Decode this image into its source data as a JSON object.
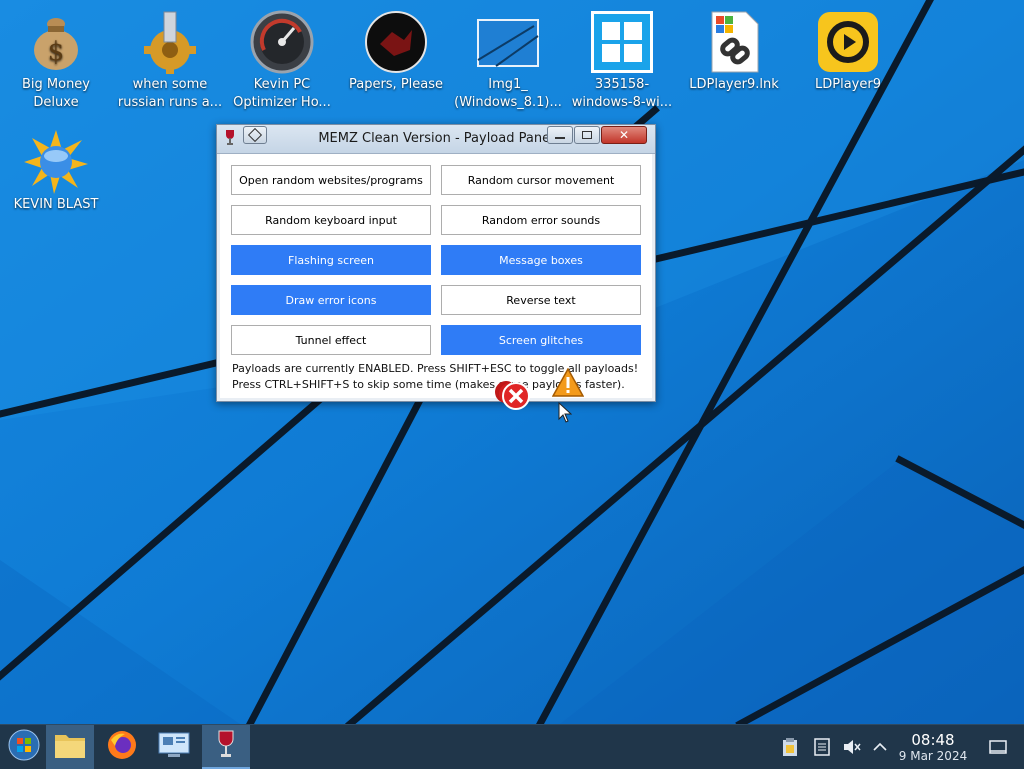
{
  "desktop_icons": [
    {
      "label_line1": "Big Money",
      "label_line2": "Deluxe",
      "icon": "money-bag-icon"
    },
    {
      "label_line1": "when some",
      "label_line2": "russian runs a...",
      "icon": "gear-icon"
    },
    {
      "label_line1": "Kevin PC",
      "label_line2": "Optimizer Ho...",
      "icon": "speedometer-icon"
    },
    {
      "label_line1": "Papers, Please",
      "label_line2": "",
      "icon": "papers-please-icon"
    },
    {
      "label_line1": "Img1_",
      "label_line2": "(Windows_8.1)...",
      "icon": "image-file-icon"
    },
    {
      "label_line1": "335158-",
      "label_line2": "windows-8-wi...",
      "icon": "windows-logo-icon"
    },
    {
      "label_line1": "LDPlayer9.lnk",
      "label_line2": "",
      "icon": "shortcut-link-icon"
    },
    {
      "label_line1": "LDPlayer9",
      "label_line2": "",
      "icon": "ldplayer-icon"
    },
    {
      "label_line1": "KEVIN BLAST",
      "label_line2": "",
      "icon": "globe-burst-icon"
    }
  ],
  "window": {
    "title": "MEMZ Clean Version - Payload Panel",
    "buttons": [
      {
        "label": "Open random websites/programs",
        "enabled": false
      },
      {
        "label": "Random cursor movement",
        "enabled": false
      },
      {
        "label": "Random keyboard input",
        "enabled": false
      },
      {
        "label": "Random error sounds",
        "enabled": false
      },
      {
        "label": "Flashing screen",
        "enabled": true
      },
      {
        "label": "Message boxes",
        "enabled": true
      },
      {
        "label": "Draw error icons",
        "enabled": true
      },
      {
        "label": "Reverse text",
        "enabled": false
      },
      {
        "label": "Tunnel effect",
        "enabled": false
      },
      {
        "label": "Screen glitches",
        "enabled": true
      }
    ],
    "status_line1": "Payloads are currently ENABLED. Press SHIFT+ESC to toggle all payloads!",
    "status_line2": "Press CTRL+SHIFT+S to skip some time (makes some payloads faster)."
  },
  "taskbar": {
    "apps": [
      "start-orb-icon",
      "file-manager-icon",
      "firefox-icon",
      "remote-desktop-icon",
      "wine-glass-icon"
    ],
    "time": "08:48",
    "date": "9 Mar 2024"
  },
  "colors": {
    "enabled_button": "#2f7cf6",
    "taskbar": "#20364a",
    "wallpaper": "#1a7fd6"
  }
}
